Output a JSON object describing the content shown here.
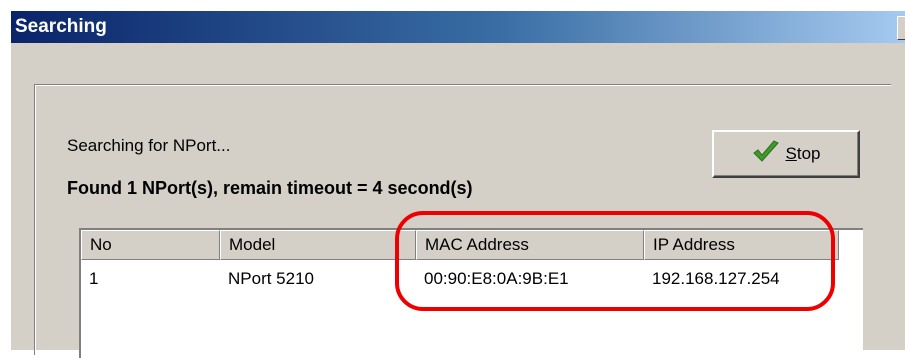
{
  "window": {
    "title": "Searching"
  },
  "status": {
    "searching_text": "Searching for NPort...",
    "found_text": "Found 1 NPort(s), remain timeout = 4 second(s)"
  },
  "stop_button": {
    "label_underlined": "S",
    "label_rest": "top",
    "icon": "checkmark-icon"
  },
  "table": {
    "columns": [
      "No",
      "Model",
      "MAC Address",
      "IP Address"
    ],
    "rows": [
      [
        "1",
        "NPort 5210",
        "00:90:E8:0A:9B:E1",
        "192.168.127.254"
      ]
    ]
  },
  "colors": {
    "annotation": "#ee0000",
    "titlebar_start": "#0a246a",
    "titlebar_end": "#a6caf0",
    "check": "#3f9a2a"
  }
}
